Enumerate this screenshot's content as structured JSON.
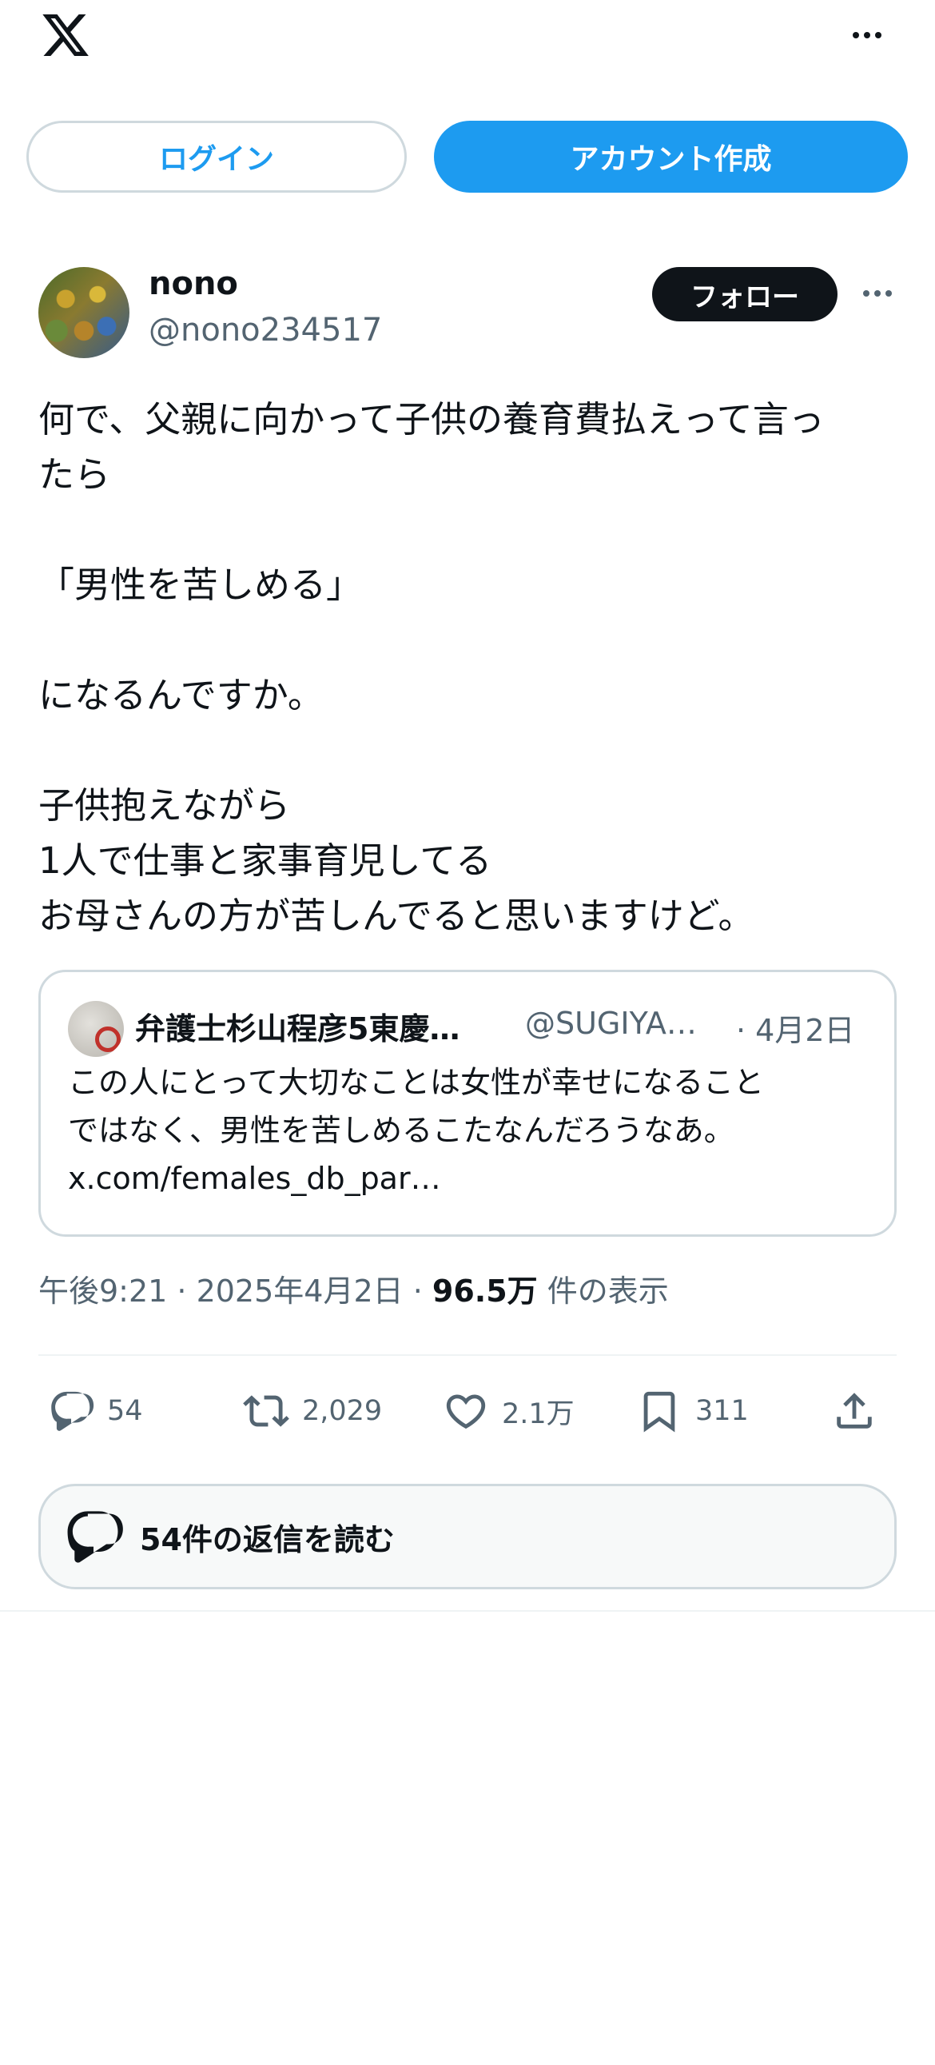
{
  "header": {
    "logo_icon": "x-logo-icon",
    "more_icon": "more-horizontal-icon"
  },
  "auth": {
    "login_label": "ログイン",
    "signup_label": "アカウント作成"
  },
  "post": {
    "display_name": "nono",
    "handle": "@nono234517",
    "follow_label": "フォロー",
    "text_lines": [
      "何で、父親に向かって子供の養育費払えって言っ",
      "たら",
      "",
      "「男性を苦しめる」",
      "",
      "になるんですか。",
      "",
      "子供抱えながら",
      "1人で仕事と家事育児してる",
      "お母さんの方が苦しんでると思いますけど。"
    ],
    "quote": {
      "name": "弁護士杉山程彦5東慶…",
      "handle": "@SUGIYA…",
      "date": "· 4月2日",
      "text_lines": [
        "この人にとって大切なことは女性が幸せになること",
        "ではなく、男性を苦しめるこたなんだろうなあ。",
        "x.com/females_db_par…"
      ]
    },
    "meta": {
      "time_date": "午後9:21 · 2025年4月2日 · ",
      "views": "96.5万",
      "views_suffix": " 件の表示"
    },
    "actions": {
      "replies": "54",
      "reposts": "2,029",
      "likes": "2.1万",
      "bookmarks": "311"
    },
    "read_replies_label": "54件の返信を読む"
  },
  "colors": {
    "accent": "#1d9bf0",
    "text": "#0f1419",
    "secondary": "#536471",
    "border": "#cfd9de"
  }
}
